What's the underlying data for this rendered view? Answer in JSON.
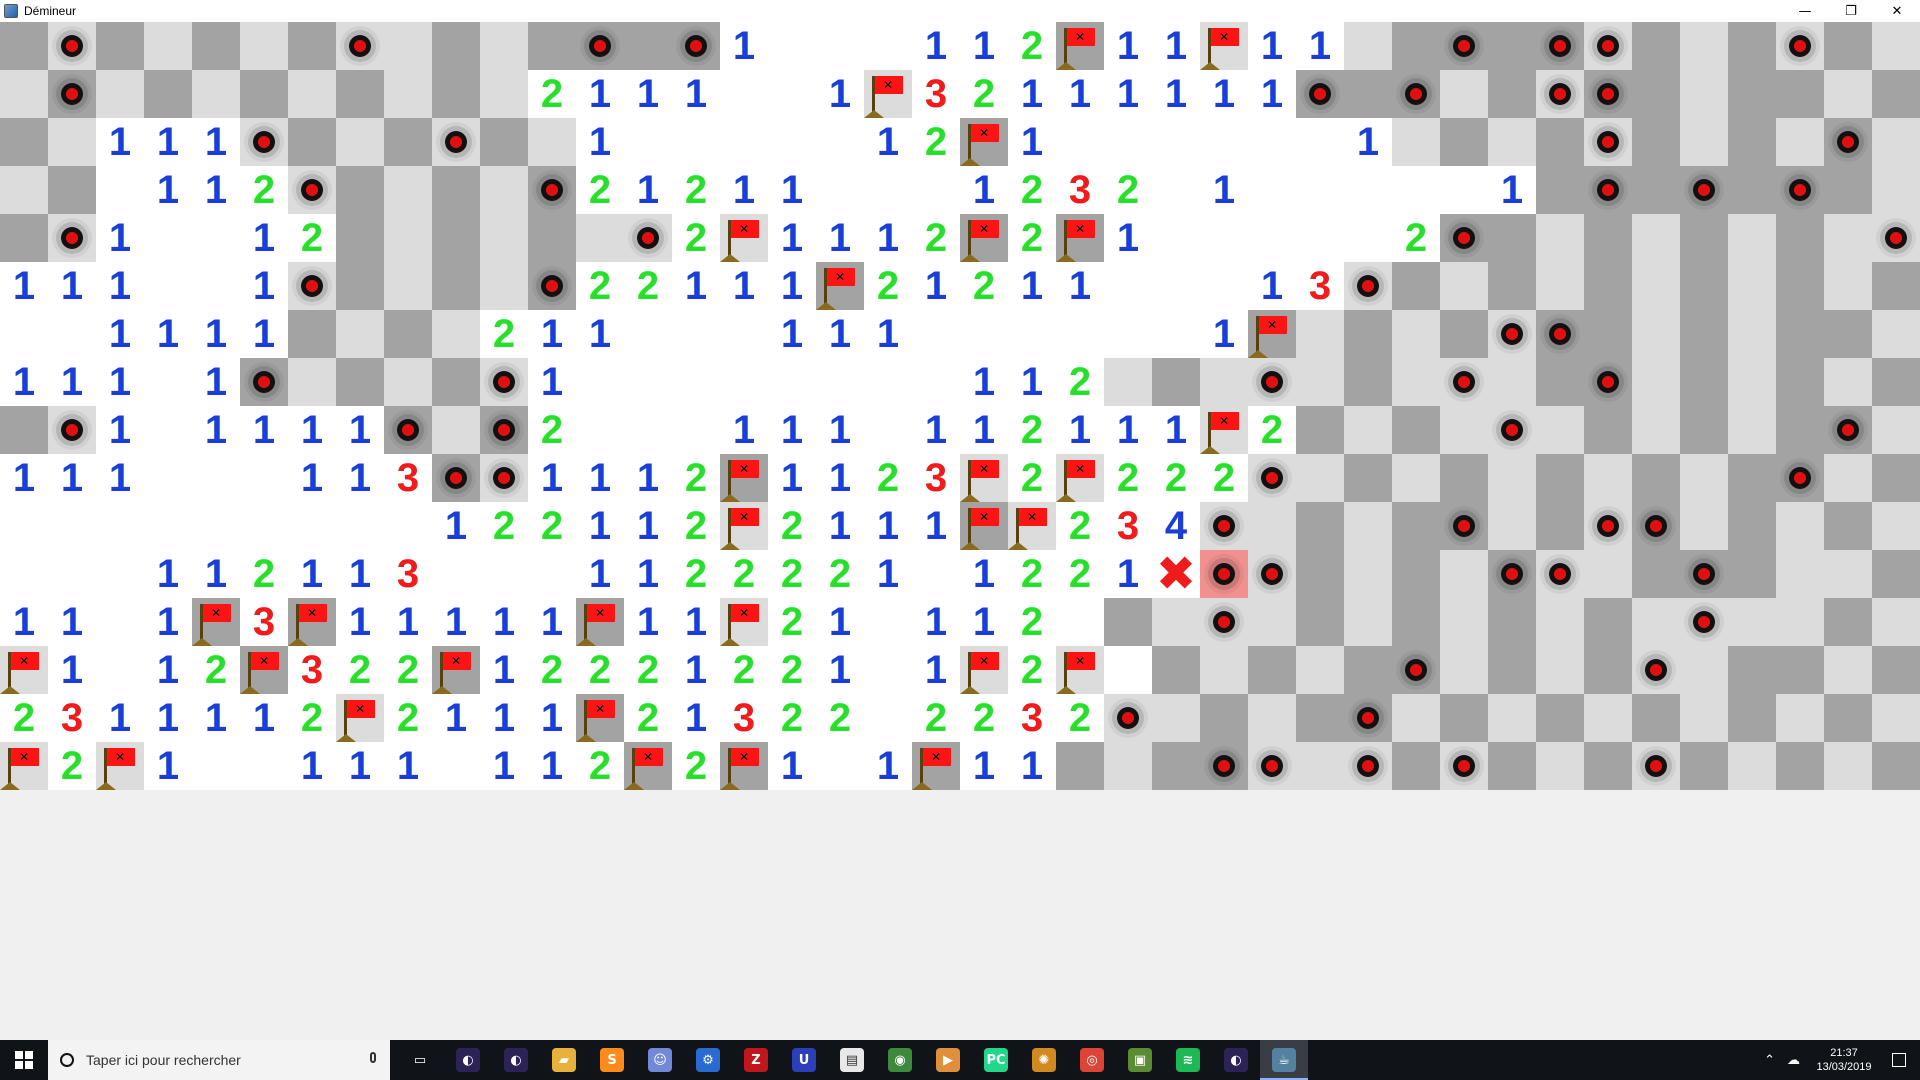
{
  "window": {
    "title": "Démineur"
  },
  "board": {
    "rows": [
      "DMDLDLDMLDLDMDM1...112F11F11LDMDMMDLDM",
      "LMLDLDLDLDL2111..1F32111111MDMLDMMDLD",
      "DL111MDLDMDL1.....12F1......1LDLDMDLDLM",
      "LD.112MDLDLM21211...1232.1.....1DMDMDMDLMD",
      "DM1..12DLDLDLM2F1112F2F1.....2MDLDLDLDLM",
      "111..1MDLDLM22111F21211...13MDLDLDLDLD",
      "..1111DLDL211...111......1FLDLDMMDLDLD",
      "111.1MLDLDM1........112LDLMLDLMLDM",
      "DM1.1111MLM2...111.112111F2DLDLMLDLDLDM",
      "111...113MM1112F1123F2F222MLDLDLDLDLDM",
      ".........122112F2111FF234MLDLDMLDMMLDL",
      "...112113...1122221.1221XBMDLDLMMLDMDL",
      "11.1F3F11111F11F21.112.DLMLDLDLDLDLML",
      "F1.12F322F12221221.1F2F.DLDLDMLDLDMLD",
      "2311112F2111F21322.2232MLDLDMLDLDLDLD",
      "F2F1..111.112F2F1.1F11DLDMMLMDMDLDMDLD"
    ]
  },
  "taskbar": {
    "search_placeholder": "Taper ici pour rechercher",
    "apps": [
      "task-view",
      "eclipse",
      "eclipse",
      "file-explorer",
      "sublime-text",
      "discord",
      "network-tool",
      "filezilla",
      "ultraedit",
      "notepad",
      "globe",
      "media",
      "pycharm",
      "settings",
      "chrome",
      "minecraft",
      "spotify",
      "eclipse",
      "java"
    ],
    "clock_time": "21:37",
    "clock_date": "13/03/2019"
  },
  "colors": {
    "one": "#1a3fd6",
    "two": "#28e02a",
    "three": "#ee1c1c",
    "tile_dark": "#a3a3a3",
    "tile_light": "#dcdcdc",
    "exploded": "#f29090"
  }
}
